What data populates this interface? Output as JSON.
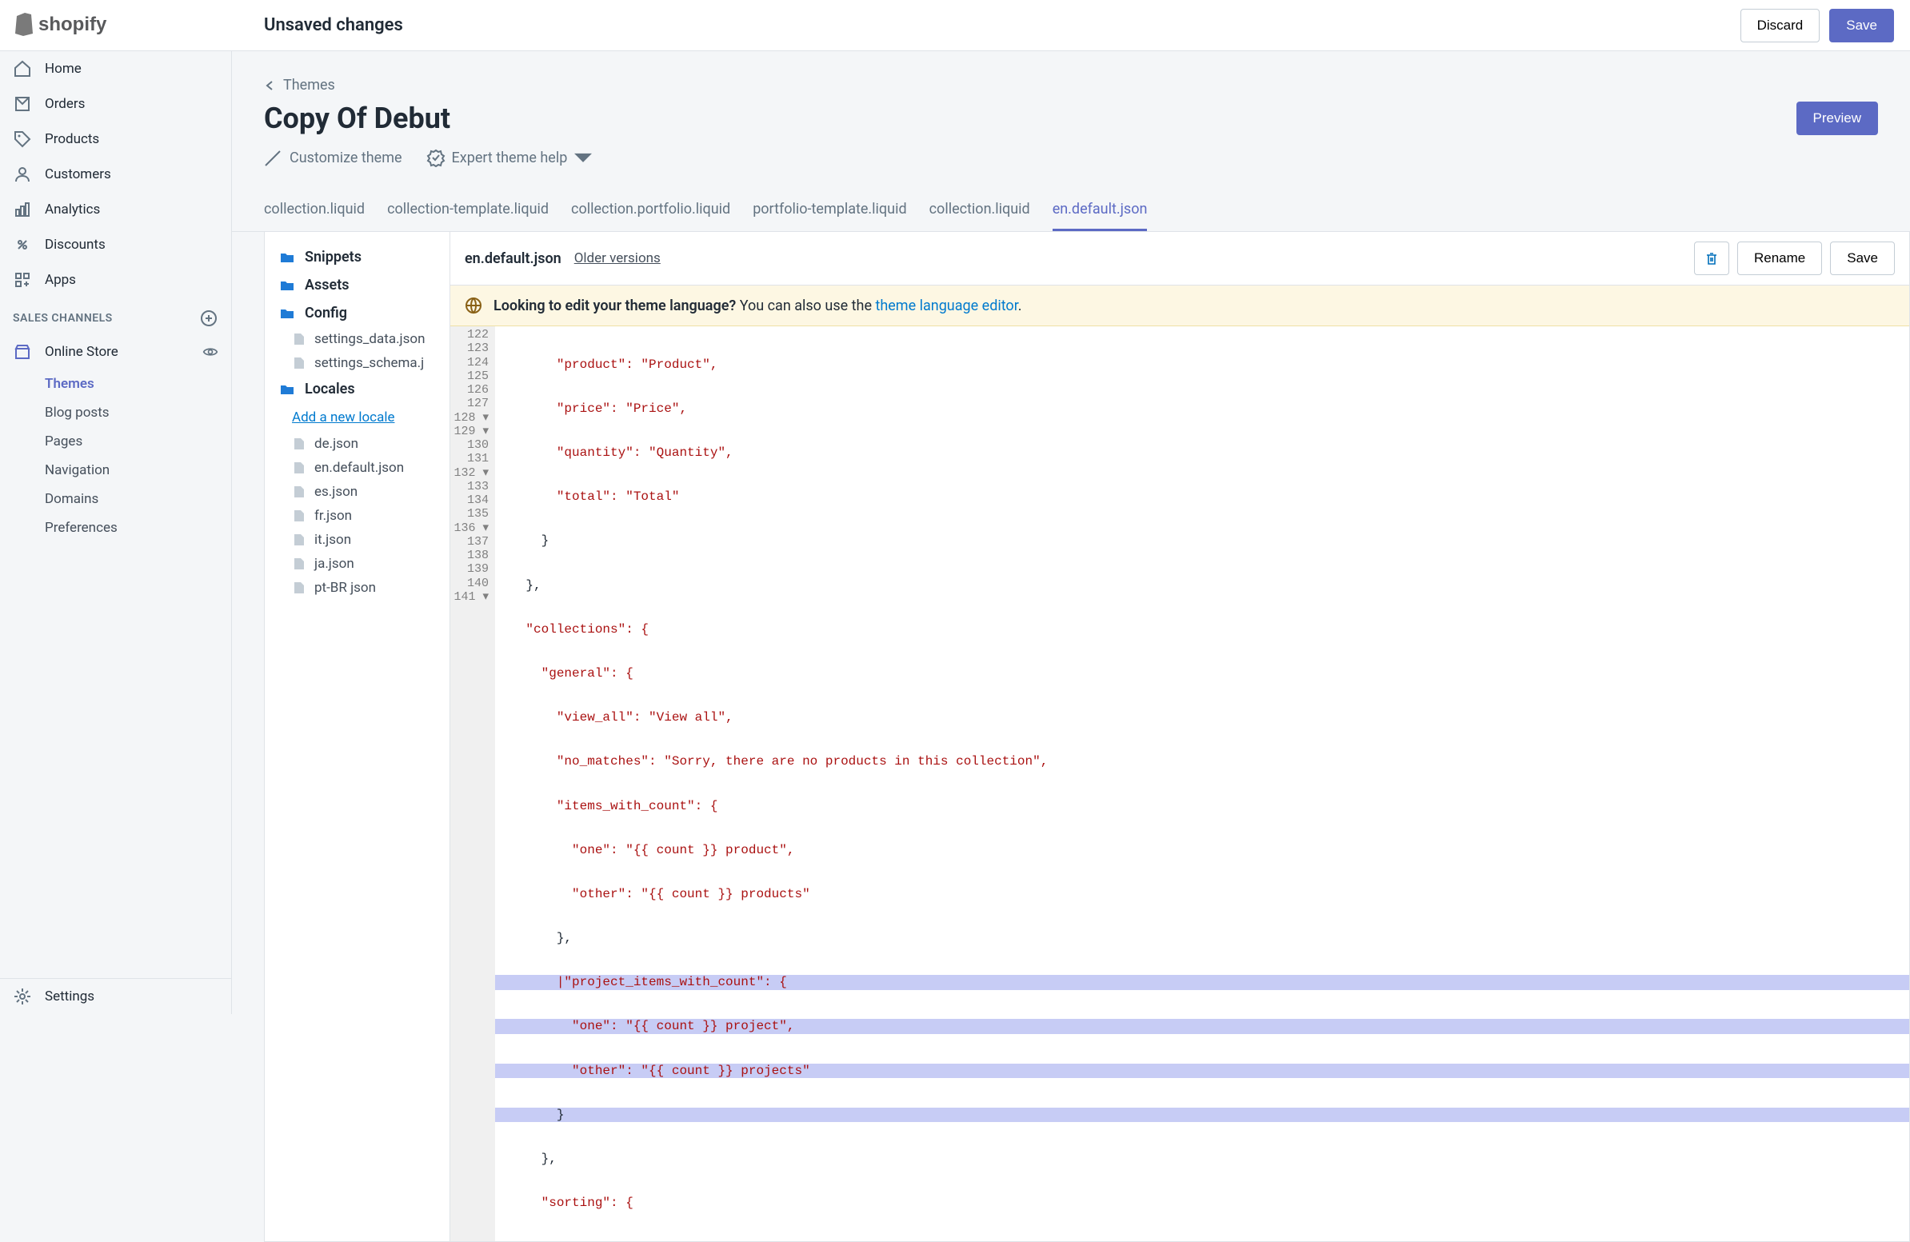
{
  "brand": "shopify",
  "top": {
    "status": "Unsaved changes",
    "discard": "Discard",
    "save": "Save"
  },
  "nav": {
    "home": "Home",
    "orders": "Orders",
    "products": "Products",
    "customers": "Customers",
    "analytics": "Analytics",
    "discounts": "Discounts",
    "apps": "Apps",
    "sales_channels": "SALES CHANNELS",
    "online_store": "Online Store",
    "themes": "Themes",
    "blog_posts": "Blog posts",
    "pages": "Pages",
    "navigation": "Navigation",
    "domains": "Domains",
    "preferences": "Preferences",
    "settings": "Settings"
  },
  "page": {
    "breadcrumb": "Themes",
    "title": "Copy Of Debut",
    "customize": "Customize theme",
    "expert_help": "Expert theme help",
    "preview": "Preview"
  },
  "tabs": {
    "t1": "collection.liquid",
    "t2": "collection-template.liquid",
    "t3": "collection.portfolio.liquid",
    "t4": "portfolio-template.liquid",
    "t5": "collection.liquid",
    "t6": "en.default.json"
  },
  "tree": {
    "snippets": "Snippets",
    "assets": "Assets",
    "config": "Config",
    "settings_data": "settings_data.json",
    "settings_schema": "settings_schema.j",
    "locales": "Locales",
    "add_locale": "Add a new locale",
    "de": "de.json",
    "en_default": "en.default.json",
    "es": "es.json",
    "fr": "fr.json",
    "it": "it.json",
    "ja": "ja.json",
    "pt": "pt-BR json"
  },
  "code_header": {
    "filename": "en.default.json",
    "older": "Older versions",
    "rename": "Rename",
    "save": "Save"
  },
  "notice": {
    "bold": "Looking to edit your theme language?",
    "text": " You can also use the ",
    "link": "theme language editor",
    "dot": "."
  },
  "gutter": [
    "122",
    "123",
    "124",
    "125",
    "126",
    "127",
    "128 ▾",
    "129 ▾",
    "130",
    "131",
    "132 ▾",
    "133",
    "134",
    "135",
    "136 ▾",
    "137",
    "138",
    "139",
    "140",
    "141 ▾"
  ],
  "code": {
    "l122": "        \"product\": \"Product\",",
    "l123": "        \"price\": \"Price\",",
    "l124": "        \"quantity\": \"Quantity\",",
    "l125": "        \"total\": \"Total\"",
    "l126": "      }",
    "l127": "    },",
    "l128": "    \"collections\": {",
    "l129": "      \"general\": {",
    "l130": "        \"view_all\": \"View all\",",
    "l131": "        \"no_matches\": \"Sorry, there are no products in this collection\",",
    "l132": "        \"items_with_count\": {",
    "l133": "          \"one\": \"{{ count }} product\",",
    "l134": "          \"other\": \"{{ count }} products\"",
    "l135": "        },",
    "l136": "        |\"project_items_with_count\": {",
    "l137": "          \"one\": \"{{ count }} project\",",
    "l138": "          \"other\": \"{{ count }} projects\"",
    "l139": "        }",
    "l140": "      },",
    "l141": "      \"sorting\": {"
  }
}
